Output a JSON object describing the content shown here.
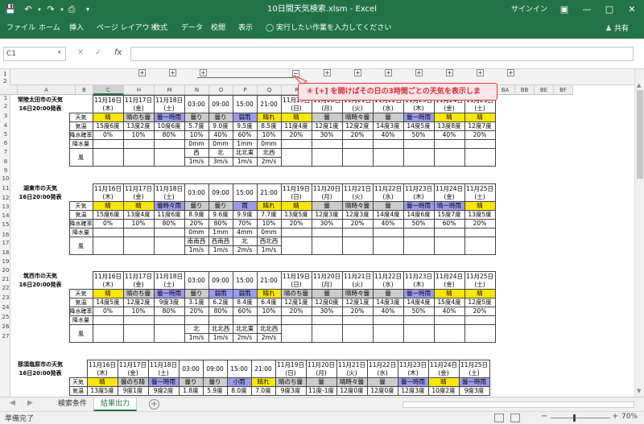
{
  "app": {
    "title": "10日間天気検索.xlsm  -  Excel",
    "signin": "サインイン",
    "share": "共有"
  },
  "ribbon": {
    "tabs": [
      "ファイル",
      "ホーム",
      "挿入",
      "ページ レイアウト",
      "数式",
      "データ",
      "校閲",
      "表示"
    ],
    "tell_me": "実行したい作業を入力してください"
  },
  "formula_bar": {
    "name_box": "C1",
    "fx": "fx",
    "content": ""
  },
  "columns": [
    "A",
    "B",
    "C",
    "H",
    "M",
    "N",
    "O",
    "P",
    "Q",
    "R",
    "W",
    "AB",
    "AG",
    "AL",
    "AQ",
    "AV",
    "BA",
    "BB",
    "BE",
    "BF"
  ],
  "selected_column": "C",
  "outline_levels": [
    "1",
    "2"
  ],
  "rows": [
    "1",
    "2",
    "3",
    "4",
    "5",
    "6",
    "7",
    "8",
    "9",
    "10",
    "11",
    "12",
    "13",
    "14",
    "15",
    "16",
    "17",
    "18",
    "19",
    "20",
    "21",
    "22",
    "23",
    "24",
    "25",
    "26",
    "27"
  ],
  "callout": "④ [+] を開けばその日の3時間ごとの天気を表示しま",
  "row_labels": {
    "weather": "天気",
    "temp": "気温",
    "precip_prob": "降水確率",
    "precip": "降水量",
    "wind": "風"
  },
  "days": [
    {
      "date": "11月16日",
      "dow": "(木)"
    },
    {
      "date": "11月17日",
      "dow": "(金)"
    },
    {
      "date": "11月18日",
      "dow": "(土)"
    }
  ],
  "hours": [
    "03:00",
    "09:00",
    "15:00",
    "21:00"
  ],
  "later_days": [
    {
      "date": "11月19日",
      "dow": "(日)"
    },
    {
      "date": "11月20日",
      "dow": "(月)"
    },
    {
      "date": "11月21日",
      "dow": "(火)"
    },
    {
      "date": "11月22日",
      "dow": "(水)"
    },
    {
      "date": "11月23日",
      "dow": "(木)"
    },
    {
      "date": "11月24日",
      "dow": "(金)"
    },
    {
      "date": "11月25日",
      "dow": "(土)"
    }
  ],
  "cities": [
    {
      "name": "常陸太田市の天気",
      "issued": "16日20:00発表",
      "weather": [
        {
          "t": "晴",
          "c": "sun"
        },
        {
          "t": "晴のち曇",
          "c": "cloud"
        },
        {
          "t": "曇一時雨",
          "c": "rain"
        },
        {
          "t": "曇り",
          "c": "cloud"
        },
        {
          "t": "曇り",
          "c": "cloud"
        },
        {
          "t": "弱雨",
          "c": "rain"
        },
        {
          "t": "晴れ",
          "c": "sun"
        },
        {
          "t": "晴",
          "c": "sun"
        },
        {
          "t": "曇",
          "c": "cloud"
        },
        {
          "t": "晴時々曇",
          "c": "cloud"
        },
        {
          "t": "曇",
          "c": "cloud"
        },
        {
          "t": "曇一時雨",
          "c": "rain"
        },
        {
          "t": "晴",
          "c": "sun"
        },
        {
          "t": "晴",
          "c": "sun"
        }
      ],
      "temp": [
        "15度6度",
        "13度2度",
        "10度6度",
        "5.7度",
        "9.0度",
        "9.5度",
        "8.5度",
        "11度4度",
        "12度1度",
        "12度2度",
        "14度3度",
        "14度5度",
        "13度8度",
        "12度7度"
      ],
      "prob": [
        "0%",
        "10%",
        "80%",
        "10%",
        "40%",
        "60%",
        "10%",
        "20%",
        "30%",
        "20%",
        "40%",
        "50%",
        "40%",
        "20%"
      ],
      "precip": [
        "0mm",
        "0mm",
        "1mm",
        "0mm"
      ],
      "wind_dir": [
        "西",
        "北",
        "北北東",
        "北西"
      ],
      "wind_spd": [
        "1m/s",
        "3m/s",
        "1m/s",
        "2m/s"
      ]
    },
    {
      "name": "湖東市の天気",
      "issued": "16日20:00発表",
      "weather": [
        {
          "t": "晴",
          "c": "sun"
        },
        {
          "t": "晴",
          "c": "sun"
        },
        {
          "t": "曇時々雨",
          "c": "rain"
        },
        {
          "t": "曇り",
          "c": "cloud"
        },
        {
          "t": "曇り",
          "c": "cloud"
        },
        {
          "t": "雨",
          "c": "rain"
        },
        {
          "t": "晴れ",
          "c": "sun"
        },
        {
          "t": "晴",
          "c": "sun"
        },
        {
          "t": "曇",
          "c": "cloud"
        },
        {
          "t": "晴時々曇",
          "c": "cloud"
        },
        {
          "t": "曇",
          "c": "cloud"
        },
        {
          "t": "曇一時雨",
          "c": "rain"
        },
        {
          "t": "晴一時雨",
          "c": "rain"
        },
        {
          "t": "晴",
          "c": "sun"
        }
      ],
      "temp": [
        "15度6度",
        "13度4度",
        "11度6度",
        "8.9度",
        "9.6度",
        "9.9度",
        "7.7度",
        "13度5度",
        "12度3度",
        "12度3度",
        "14度4度",
        "14度6度",
        "15度7度",
        "13度5度"
      ],
      "prob": [
        "0%",
        "10%",
        "80%",
        "20%",
        "80%",
        "70%",
        "10%",
        "20%",
        "30%",
        "20%",
        "40%",
        "50%",
        "60%",
        "20%"
      ],
      "precip": [
        "0mm",
        "1mm",
        "4mm",
        "0mm"
      ],
      "wind_dir": [
        "南南西",
        "西南西",
        "北",
        "西北西"
      ],
      "wind_spd": [
        "1m/s",
        "1m/s",
        "2m/s",
        "1m/s"
      ]
    },
    {
      "name": "筑西市の天気",
      "issued": "16日20:00発表",
      "weather": [
        {
          "t": "晴",
          "c": "sun"
        },
        {
          "t": "晴のち曇",
          "c": "cloud"
        },
        {
          "t": "曇一時雨",
          "c": "rain"
        },
        {
          "t": "曇り",
          "c": "cloud"
        },
        {
          "t": "弱雨",
          "c": "rain"
        },
        {
          "t": "弱雨",
          "c": "rain"
        },
        {
          "t": "晴れ",
          "c": "sun"
        },
        {
          "t": "晴のち曇",
          "c": "cloud"
        },
        {
          "t": "曇",
          "c": "cloud"
        },
        {
          "t": "晴時々曇",
          "c": "cloud"
        },
        {
          "t": "曇",
          "c": "cloud"
        },
        {
          "t": "曇一時雨",
          "c": "rain"
        },
        {
          "t": "晴",
          "c": "sun"
        },
        {
          "t": "晴",
          "c": "sun"
        }
      ],
      "temp": [
        "14度5度",
        "12度2度",
        "9度3度",
        "3.1度",
        "6.2度",
        "8.4度",
        "6.4度",
        "12度1度",
        "12度0度",
        "12度1度",
        "14度3度",
        "14度4度",
        "15度4度",
        "12度5度"
      ],
      "prob": [
        "0%",
        "10%",
        "80%",
        "20%",
        "80%",
        "60%",
        "10%",
        "20%",
        "30%",
        "20%",
        "40%",
        "50%",
        "40%",
        "20%"
      ],
      "precip": [
        "",
        "",
        "",
        ""
      ],
      "wind_dir": [
        "北",
        "北北西",
        "北北東",
        "北北西"
      ],
      "wind_spd": [
        "1m/s",
        "1m/s",
        "2m/s",
        "2m/s"
      ]
    },
    {
      "name": "那須塩原市の天気",
      "issued": "16日20:00発表",
      "weather": [
        {
          "t": "晴",
          "c": "sun"
        },
        {
          "t": "曇のち晴",
          "c": "cloud"
        },
        {
          "t": "曇一時雨",
          "c": "rain"
        },
        {
          "t": "曇り",
          "c": "cloud"
        },
        {
          "t": "曇り",
          "c": "cloud"
        },
        {
          "t": "小雨",
          "c": "rain"
        },
        {
          "t": "晴れ",
          "c": "sun"
        },
        {
          "t": "晴のち曇",
          "c": "cloud"
        },
        {
          "t": "曇",
          "c": "cloud"
        },
        {
          "t": "晴時々曇",
          "c": "cloud"
        },
        {
          "t": "曇",
          "c": "cloud"
        },
        {
          "t": "曇一時雨",
          "c": "rain"
        },
        {
          "t": "晴",
          "c": "sun"
        },
        {
          "t": "曇一時雨",
          "c": "rain"
        }
      ],
      "temp": [
        "13度5度",
        "9度1度",
        "9度2度",
        "1.8度",
        "5.9度",
        "8.0度",
        "7.0度",
        "9度3度",
        "11度-1度",
        "12度0度",
        "12度0度",
        "12度3度",
        "10度2度",
        "9度3度"
      ],
      "prob": [],
      "precip": [],
      "wind_dir": [],
      "wind_spd": []
    }
  ],
  "sheet_tabs": [
    "検索条件",
    "結果出力"
  ],
  "active_sheet": "結果出力",
  "status": {
    "ready": "準備完了",
    "zoom": "70%"
  }
}
